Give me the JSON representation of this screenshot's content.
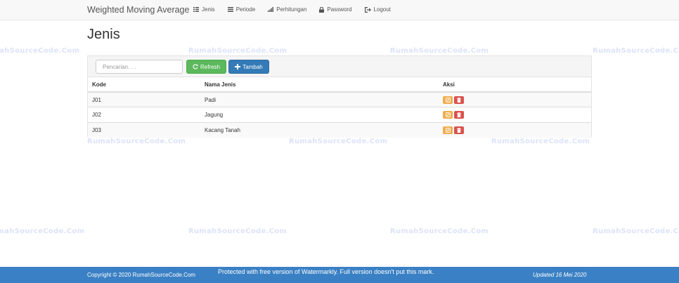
{
  "navbar": {
    "brand": "Weighted Moving Average",
    "items": [
      {
        "label": "Jenis",
        "icon": "grid-icon"
      },
      {
        "label": "Periode",
        "icon": "list-icon"
      },
      {
        "label": "Perhitungan",
        "icon": "bar-chart-icon"
      },
      {
        "label": "Password",
        "icon": "lock-icon"
      },
      {
        "label": "Logout",
        "icon": "logout-icon"
      }
    ]
  },
  "page": {
    "title": "Jenis"
  },
  "toolbar": {
    "search_placeholder": "Pencarian. . .",
    "search_value": "",
    "refresh_label": "Refresh",
    "add_label": "Tambah"
  },
  "table": {
    "headers": [
      "Kode",
      "Nama Jenis",
      "Aksi"
    ],
    "rows": [
      {
        "kode": "J01",
        "nama": "Padi"
      },
      {
        "kode": "J02",
        "nama": "Jagung"
      },
      {
        "kode": "J03",
        "nama": "Kacang Tanah"
      }
    ]
  },
  "watermark": {
    "text": "RumahSourceCode.Com"
  },
  "footer": {
    "copyright": "Copyright © 2020 RumahSourceCode.Com",
    "notice": "Protected with free version of Watermarkly. Full version doesn't put this mark.",
    "updated": "Updated 16 Mei 2020"
  },
  "colors": {
    "footer_bg": "#3a80c4",
    "refresh_button": "#5cb85c",
    "add_button": "#337ab7",
    "edit_button": "#f0ad4e",
    "delete_button": "#d9534f"
  }
}
